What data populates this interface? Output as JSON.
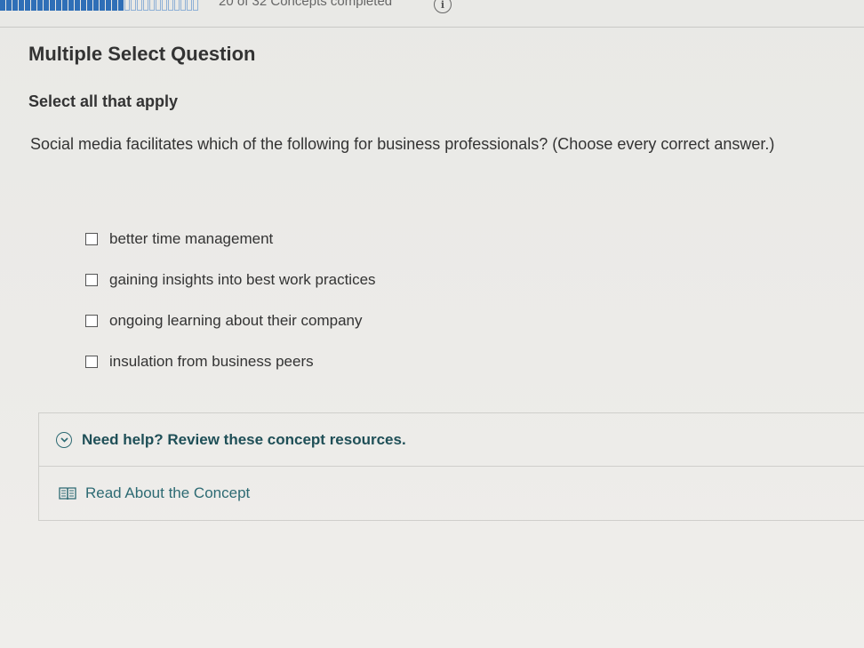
{
  "header": {
    "progress": {
      "completed": 20,
      "total": 32
    },
    "progress_label": "20 of 32 Concepts completed",
    "info_icon_label": "i"
  },
  "question": {
    "type_label": "Multiple Select Question",
    "instruction": "Select all that apply",
    "prompt": "Social media facilitates which of the following for business professionals? (Choose every correct answer.)",
    "options": [
      {
        "label": "better time management",
        "checked": false
      },
      {
        "label": "gaining insights into best work practices",
        "checked": false
      },
      {
        "label": "ongoing learning about their company",
        "checked": false
      },
      {
        "label": "insulation from business peers",
        "checked": false
      }
    ]
  },
  "help": {
    "title": "Need help? Review these concept resources.",
    "resources": [
      {
        "label": "Read About the Concept",
        "icon": "book-icon"
      }
    ]
  },
  "colors": {
    "progress_fill": "#2f6fb7",
    "link": "#2d6a73",
    "help_title": "#1f4f57"
  }
}
